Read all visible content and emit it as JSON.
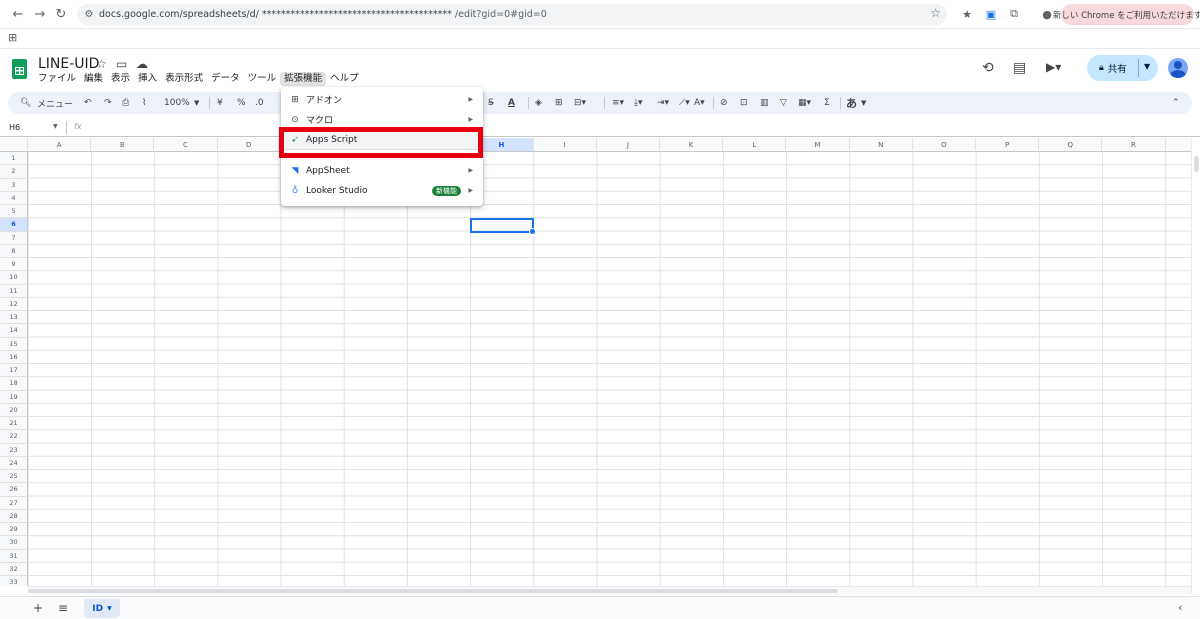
{
  "browser": {
    "url_host": "docs.google.com/spreadsheets/d/",
    "url_masked": "****************************************",
    "url_tail": "/edit?gid=0#gid=0",
    "chrome_pill": "新しい Chrome をご利用いただけます"
  },
  "doc": {
    "title": "LINE-UID",
    "menu": [
      "ファイル",
      "編集",
      "表示",
      "挿入",
      "表示形式",
      "データ",
      "ツール",
      "拡張機能",
      "ヘルプ"
    ],
    "share_label": "共有"
  },
  "toolbar": {
    "menu_search": "メニュー",
    "zoom": "100%",
    "currency": "¥",
    "percent": "%",
    "decimal_dec": ".0",
    "ime_label": "あ"
  },
  "formula_bar": {
    "cell_ref": "H6",
    "fx": "fx"
  },
  "grid": {
    "columns": [
      "A",
      "B",
      "C",
      "D",
      "E",
      "F",
      "G",
      "H",
      "I",
      "J",
      "K",
      "L",
      "M",
      "N",
      "O",
      "P",
      "Q",
      "R"
    ],
    "selected_column": "H",
    "rows": [
      "1",
      "2",
      "3",
      "4",
      "5",
      "6",
      "7",
      "8",
      "9",
      "10",
      "11",
      "12",
      "13",
      "14",
      "15",
      "16",
      "17",
      "18",
      "19",
      "20",
      "21",
      "22",
      "23",
      "24",
      "25",
      "26",
      "27",
      "28",
      "29",
      "30",
      "31",
      "32",
      "33"
    ],
    "selected_row": "6"
  },
  "extensions_menu": {
    "items": [
      {
        "label": "アドオン",
        "icon": "addon-icon",
        "has_submenu": true
      },
      {
        "label": "マクロ",
        "icon": "macro-icon",
        "has_submenu": true
      },
      {
        "label": "Apps Script",
        "icon": "apps-script-icon",
        "has_submenu": false
      },
      {
        "label": "AppSheet",
        "icon": "appsheet-icon",
        "has_submenu": true
      },
      {
        "label": "Looker Studio",
        "icon": "looker-studio-icon",
        "has_submenu": true,
        "badge": "新機能"
      }
    ]
  },
  "sheets": {
    "tabs": [
      {
        "label": "ID",
        "active": true
      }
    ]
  },
  "colors": {
    "accent": "#1a73e8",
    "highlight_box": "#e60012",
    "sheets_green": "#0f9d58",
    "badge_green": "#188038"
  }
}
